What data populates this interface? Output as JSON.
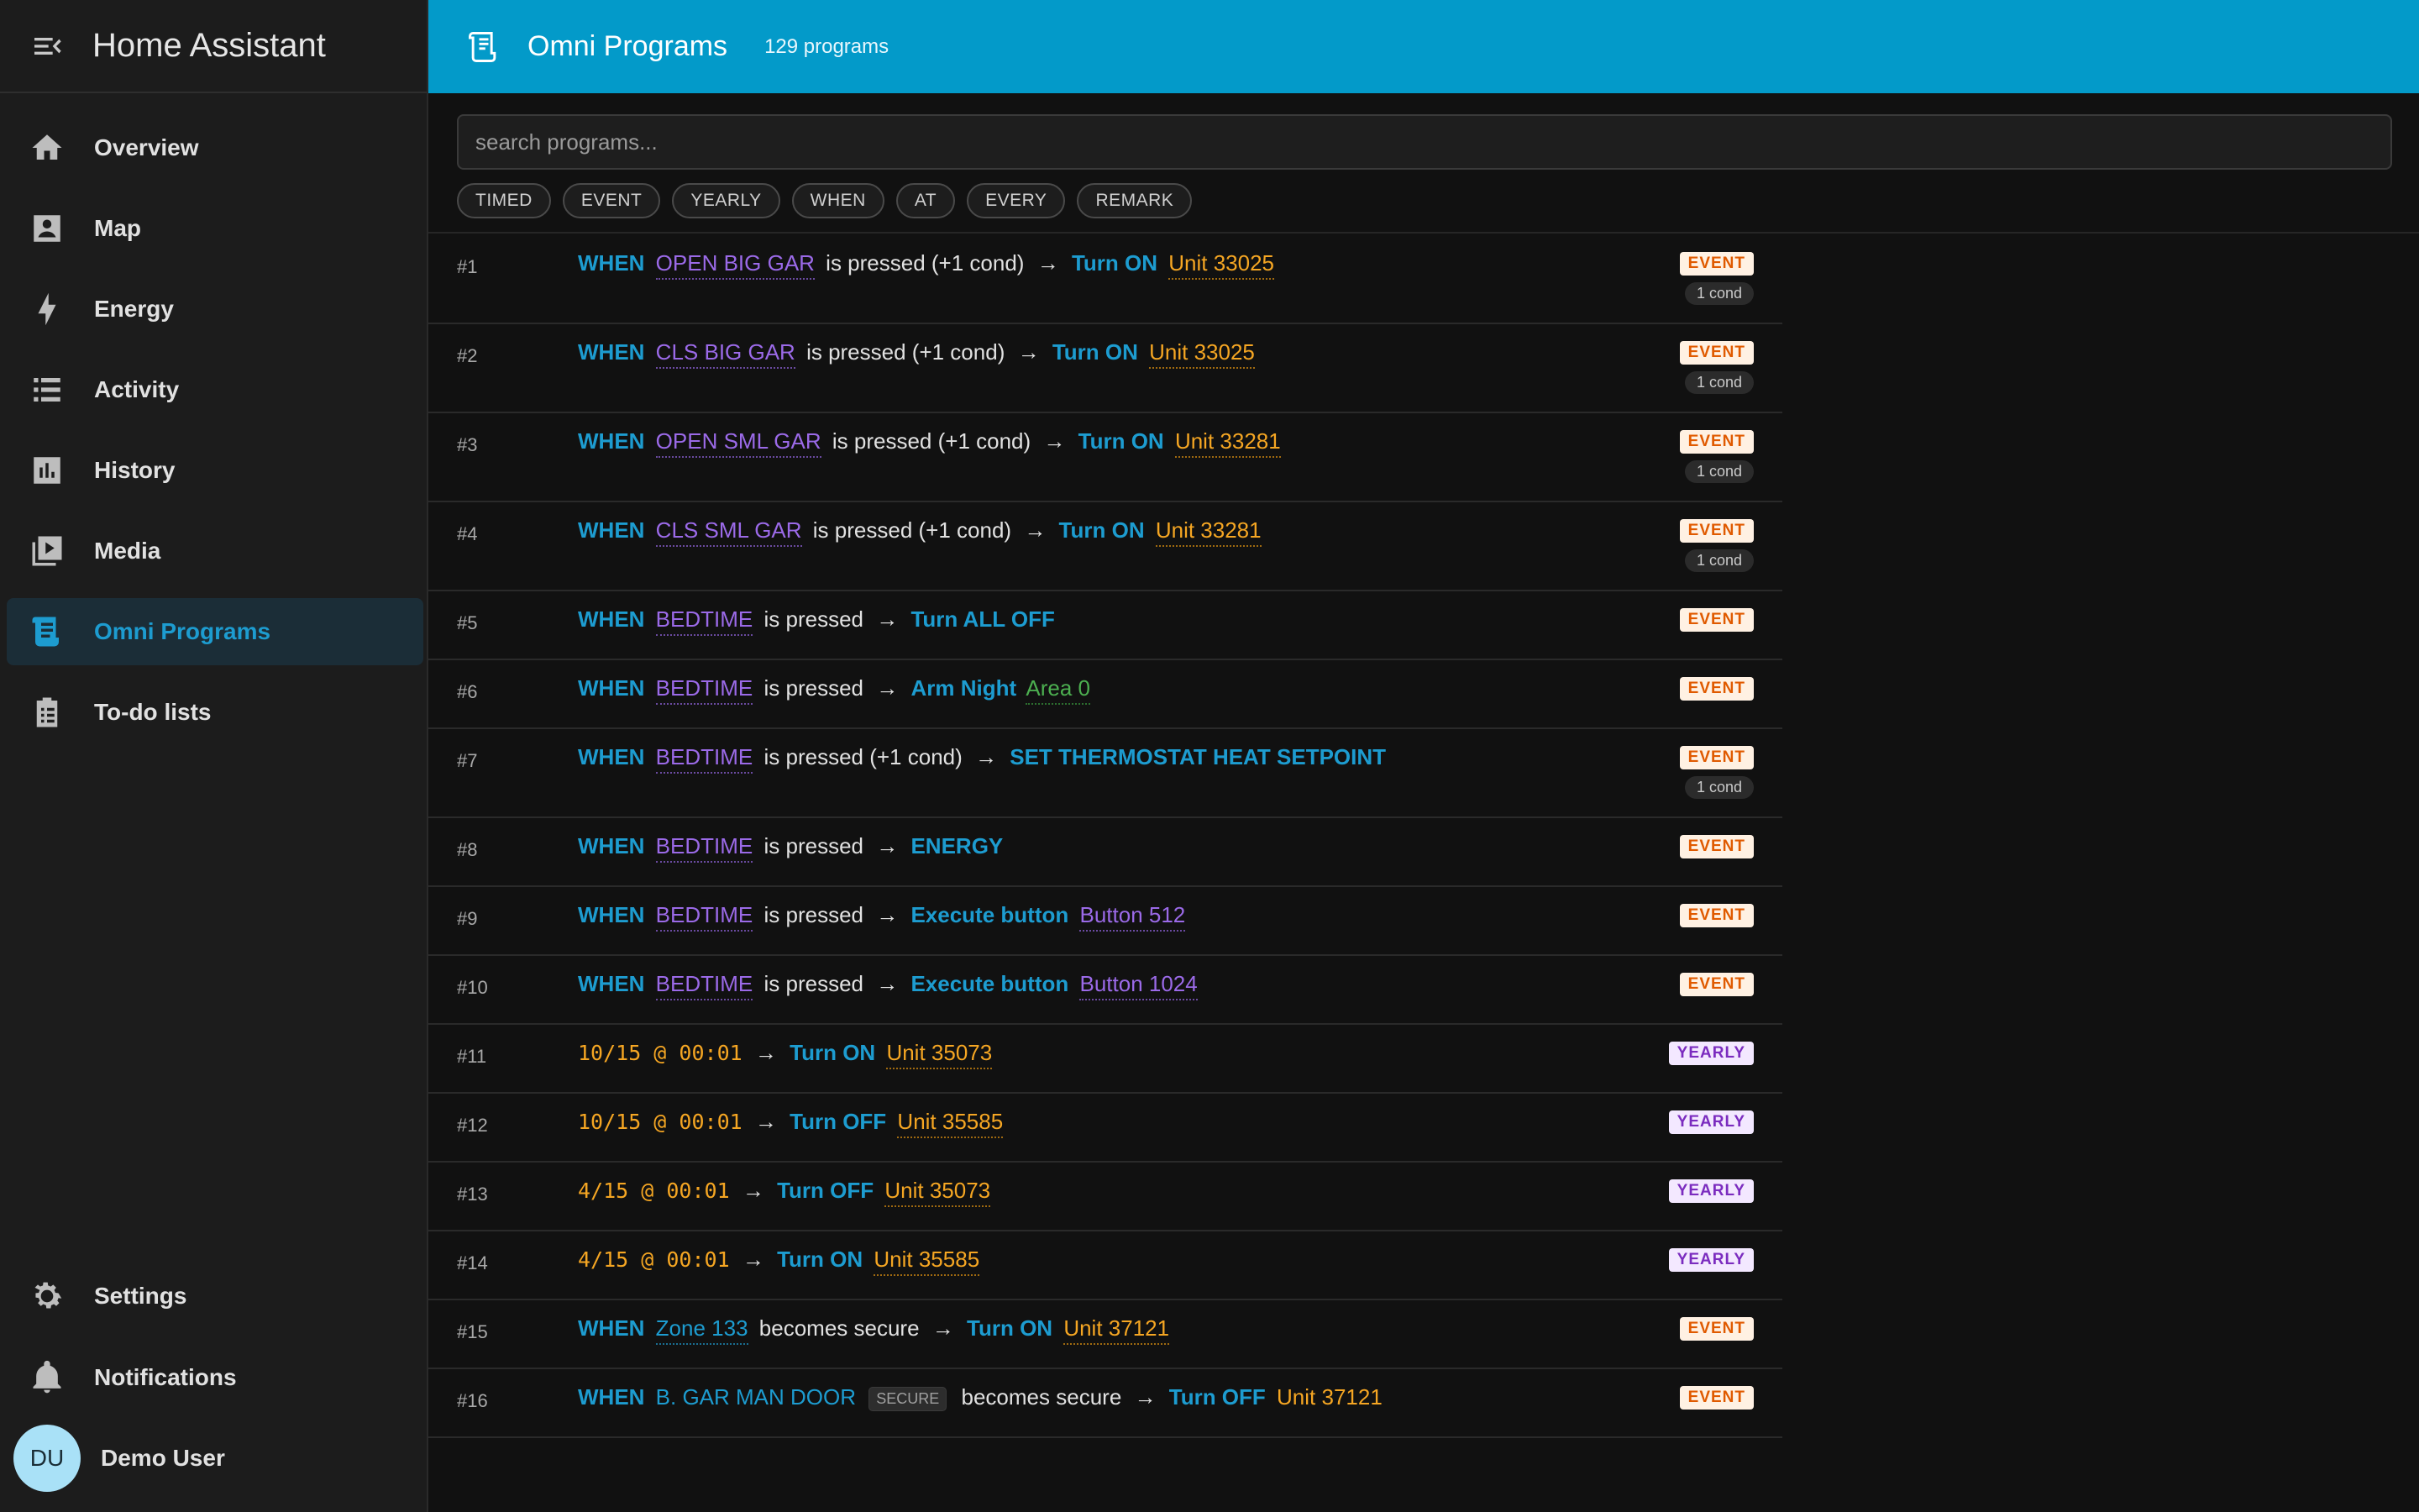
{
  "app": {
    "title": "Home Assistant"
  },
  "sidebar": {
    "items": [
      {
        "label": "Overview",
        "icon": "home-icon"
      },
      {
        "label": "Map",
        "icon": "map-icon"
      },
      {
        "label": "Energy",
        "icon": "lightning-icon"
      },
      {
        "label": "Activity",
        "icon": "list-icon"
      },
      {
        "label": "History",
        "icon": "chart-box-icon"
      },
      {
        "label": "Media",
        "icon": "play-box-icon"
      },
      {
        "label": "Omni Programs",
        "icon": "script-icon",
        "selected": true
      },
      {
        "label": "To-do lists",
        "icon": "clipboard-list-icon"
      }
    ],
    "bottom": [
      {
        "label": "Settings",
        "icon": "gear-icon"
      },
      {
        "label": "Notifications",
        "icon": "bell-icon"
      }
    ],
    "user": {
      "initials": "DU",
      "name": "Demo User"
    }
  },
  "header": {
    "title": "Omni Programs",
    "count": "129 programs"
  },
  "search": {
    "placeholder": "search programs...",
    "value": ""
  },
  "filters": [
    "TIMED",
    "EVENT",
    "YEARLY",
    "WHEN",
    "AT",
    "EVERY",
    "REMARK"
  ],
  "colors": {
    "accent": "#039ac9",
    "keyword": "#1d9cd0",
    "purple": "#9b6ae8",
    "orange": "#f5a623",
    "green": "#4caf50",
    "event_badge_bg": "#fff1e3",
    "event_badge_fg": "#e05a00",
    "yearly_badge_bg": "#f3e8ff",
    "yearly_badge_fg": "#7b2cbf"
  },
  "programs": [
    {
      "num": "#1",
      "type": "EVENT",
      "cond": "1 cond",
      "parts": [
        {
          "t": "WHEN",
          "s": "kw"
        },
        {
          "t": "OPEN BIG GAR",
          "s": "name-purple"
        },
        {
          "t": "is pressed (+1 cond)",
          "s": "plain"
        },
        {
          "t": "→",
          "s": "arrow"
        },
        {
          "t": "Turn ON",
          "s": "kw"
        },
        {
          "t": "Unit 33025",
          "s": "name-orange"
        }
      ]
    },
    {
      "num": "#2",
      "type": "EVENT",
      "cond": "1 cond",
      "parts": [
        {
          "t": "WHEN",
          "s": "kw"
        },
        {
          "t": "CLS BIG GAR",
          "s": "name-purple"
        },
        {
          "t": "is pressed (+1 cond)",
          "s": "plain"
        },
        {
          "t": "→",
          "s": "arrow"
        },
        {
          "t": "Turn ON",
          "s": "kw"
        },
        {
          "t": "Unit 33025",
          "s": "name-orange"
        }
      ]
    },
    {
      "num": "#3",
      "type": "EVENT",
      "cond": "1 cond",
      "parts": [
        {
          "t": "WHEN",
          "s": "kw"
        },
        {
          "t": "OPEN SML GAR",
          "s": "name-purple"
        },
        {
          "t": "is pressed (+1 cond)",
          "s": "plain"
        },
        {
          "t": "→",
          "s": "arrow"
        },
        {
          "t": "Turn ON",
          "s": "kw"
        },
        {
          "t": "Unit 33281",
          "s": "name-orange"
        }
      ]
    },
    {
      "num": "#4",
      "type": "EVENT",
      "cond": "1 cond",
      "parts": [
        {
          "t": "WHEN",
          "s": "kw"
        },
        {
          "t": "CLS SML GAR",
          "s": "name-purple"
        },
        {
          "t": "is pressed (+1 cond)",
          "s": "plain"
        },
        {
          "t": "→",
          "s": "arrow"
        },
        {
          "t": "Turn ON",
          "s": "kw"
        },
        {
          "t": "Unit 33281",
          "s": "name-orange"
        }
      ]
    },
    {
      "num": "#5",
      "type": "EVENT",
      "cond": "",
      "parts": [
        {
          "t": "WHEN",
          "s": "kw"
        },
        {
          "t": "BEDTIME",
          "s": "name-purple"
        },
        {
          "t": "is pressed",
          "s": "plain"
        },
        {
          "t": "→",
          "s": "arrow"
        },
        {
          "t": "Turn ALL OFF",
          "s": "kw"
        }
      ]
    },
    {
      "num": "#6",
      "type": "EVENT",
      "cond": "",
      "parts": [
        {
          "t": "WHEN",
          "s": "kw"
        },
        {
          "t": "BEDTIME",
          "s": "name-purple"
        },
        {
          "t": "is pressed",
          "s": "plain"
        },
        {
          "t": "→",
          "s": "arrow"
        },
        {
          "t": "Arm Night",
          "s": "kw"
        },
        {
          "t": "Area 0",
          "s": "name-green"
        }
      ]
    },
    {
      "num": "#7",
      "type": "EVENT",
      "cond": "1 cond",
      "parts": [
        {
          "t": "WHEN",
          "s": "kw"
        },
        {
          "t": "BEDTIME",
          "s": "name-purple"
        },
        {
          "t": "is pressed (+1 cond)",
          "s": "plain"
        },
        {
          "t": "→",
          "s": "arrow"
        },
        {
          "t": "SET THERMOSTAT HEAT SETPOINT",
          "s": "kw"
        }
      ]
    },
    {
      "num": "#8",
      "type": "EVENT",
      "cond": "",
      "parts": [
        {
          "t": "WHEN",
          "s": "kw"
        },
        {
          "t": "BEDTIME",
          "s": "name-purple"
        },
        {
          "t": "is pressed",
          "s": "plain"
        },
        {
          "t": "→",
          "s": "arrow"
        },
        {
          "t": "ENERGY",
          "s": "kw"
        }
      ]
    },
    {
      "num": "#9",
      "type": "EVENT",
      "cond": "",
      "parts": [
        {
          "t": "WHEN",
          "s": "kw"
        },
        {
          "t": "BEDTIME",
          "s": "name-purple"
        },
        {
          "t": "is pressed",
          "s": "plain"
        },
        {
          "t": "→",
          "s": "arrow"
        },
        {
          "t": "Execute button",
          "s": "kw"
        },
        {
          "t": "Button 512",
          "s": "name-purple"
        }
      ]
    },
    {
      "num": "#10",
      "type": "EVENT",
      "cond": "",
      "parts": [
        {
          "t": "WHEN",
          "s": "kw"
        },
        {
          "t": "BEDTIME",
          "s": "name-purple"
        },
        {
          "t": "is pressed",
          "s": "plain"
        },
        {
          "t": "→",
          "s": "arrow"
        },
        {
          "t": "Execute button",
          "s": "kw"
        },
        {
          "t": "Button 1024",
          "s": "name-purple"
        }
      ]
    },
    {
      "num": "#11",
      "type": "YEARLY",
      "cond": "",
      "parts": [
        {
          "t": "10/15 @ 00:01",
          "s": "time"
        },
        {
          "t": "→",
          "s": "arrow"
        },
        {
          "t": "Turn ON",
          "s": "kw"
        },
        {
          "t": "Unit 35073",
          "s": "name-orange"
        }
      ]
    },
    {
      "num": "#12",
      "type": "YEARLY",
      "cond": "",
      "parts": [
        {
          "t": "10/15 @ 00:01",
          "s": "time"
        },
        {
          "t": "→",
          "s": "arrow"
        },
        {
          "t": "Turn OFF",
          "s": "kw"
        },
        {
          "t": "Unit 35585",
          "s": "name-orange"
        }
      ]
    },
    {
      "num": "#13",
      "type": "YEARLY",
      "cond": "",
      "parts": [
        {
          "t": "4/15 @ 00:01",
          "s": "time"
        },
        {
          "t": "→",
          "s": "arrow"
        },
        {
          "t": "Turn OFF",
          "s": "kw"
        },
        {
          "t": "Unit 35073",
          "s": "name-orange"
        }
      ]
    },
    {
      "num": "#14",
      "type": "YEARLY",
      "cond": "",
      "parts": [
        {
          "t": "4/15 @ 00:01",
          "s": "time"
        },
        {
          "t": "→",
          "s": "arrow"
        },
        {
          "t": "Turn ON",
          "s": "kw"
        },
        {
          "t": "Unit 35585",
          "s": "name-orange"
        }
      ]
    },
    {
      "num": "#15",
      "type": "EVENT",
      "cond": "",
      "parts": [
        {
          "t": "WHEN",
          "s": "kw"
        },
        {
          "t": "Zone 133",
          "s": "name-blue-u"
        },
        {
          "t": "becomes secure",
          "s": "plain"
        },
        {
          "t": "→",
          "s": "arrow"
        },
        {
          "t": "Turn ON",
          "s": "kw"
        },
        {
          "t": "Unit 37121",
          "s": "name-orange"
        }
      ]
    },
    {
      "num": "#16",
      "type": "EVENT",
      "cond": "",
      "parts": [
        {
          "t": "WHEN",
          "s": "kw"
        },
        {
          "t": "B. GAR MAN DOOR",
          "s": "name-blue"
        },
        {
          "t": "SECURE",
          "s": "secure-tag"
        },
        {
          "t": "becomes secure",
          "s": "plain"
        },
        {
          "t": "→",
          "s": "arrow"
        },
        {
          "t": "Turn OFF",
          "s": "kw"
        },
        {
          "t": "Unit 37121",
          "s": "name-orange-plain"
        }
      ]
    }
  ]
}
